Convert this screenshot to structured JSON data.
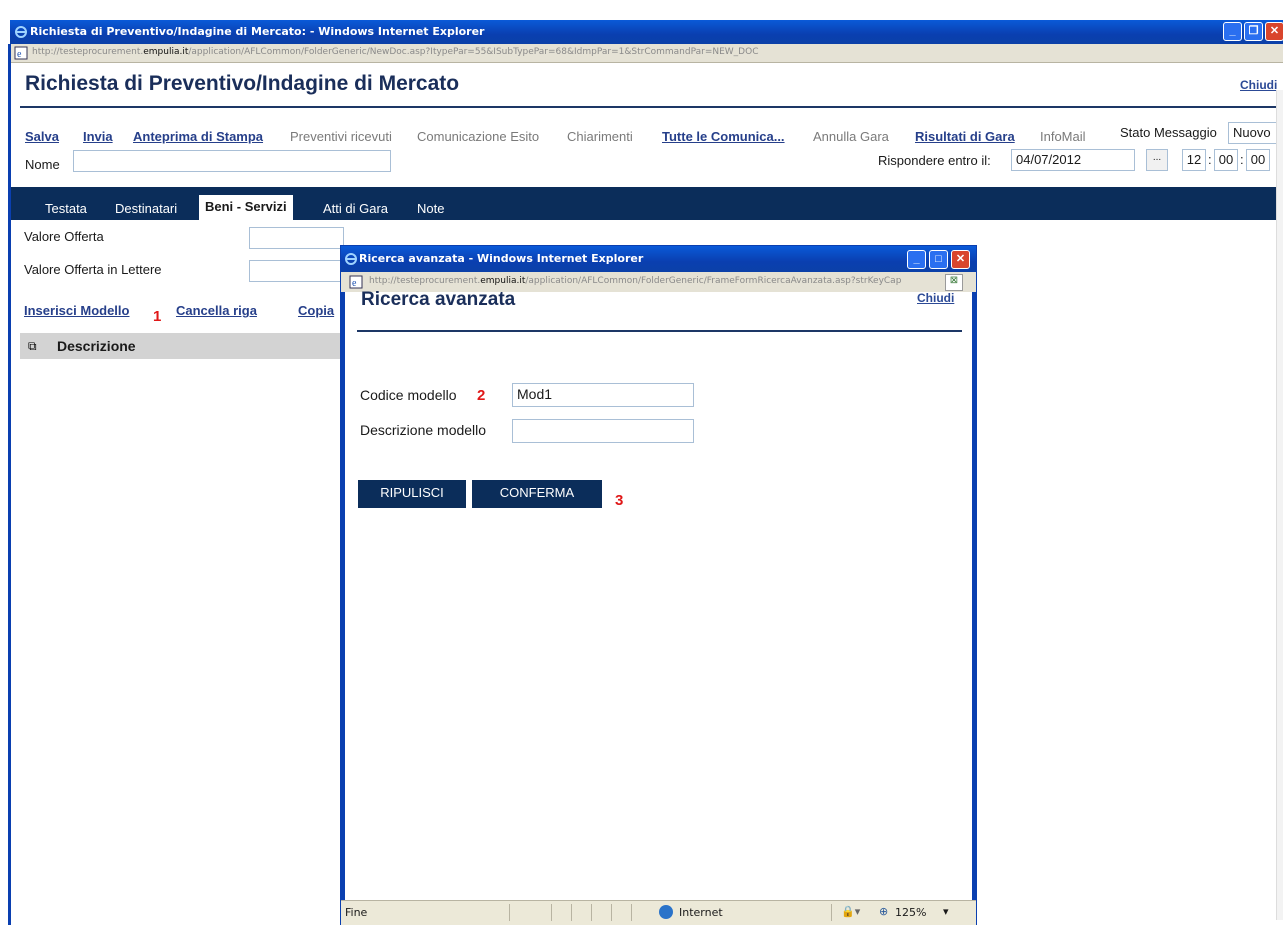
{
  "main_window": {
    "title": "Richiesta di Preventivo/Indagine di Mercato: - Windows Internet Explorer",
    "url_prefix": "http://testeprocurement.",
    "url_domain": "empulia.it",
    "url_rest": "/application/AFLCommon/FolderGeneric/NewDoc.asp?ItypePar=55&ISubTypePar=68&IdmpPar=1&StrCommandPar=NEW_DOC",
    "controls": {
      "minimize": "_",
      "maximize": "❐",
      "close": "✕"
    }
  },
  "page": {
    "title": "Richiesta di Preventivo/Indagine di Mercato",
    "close_label": "Chiudi",
    "toolbar": {
      "salva": "Salva",
      "invia": "Invia",
      "anteprima": "Anteprima di Stampa",
      "preventivi": "Preventivi ricevuti",
      "comunicazione": "Comunicazione Esito",
      "chiarimenti": "Chiarimenti",
      "tutte": "Tutte le Comunica...",
      "annulla": "Annulla Gara",
      "risultati": "Risultati di Gara",
      "infomail": "InfoMail"
    },
    "stato_label": "Stato Messaggio",
    "stato_value": "Nuovo",
    "nome_label": "Nome",
    "nome_value": "",
    "rispondere_label": "Rispondere entro il:",
    "rispondere_date": "04/07/2012",
    "date_picker_label": "...",
    "time_hour": "12",
    "time_min": "00",
    "time_sec": "00",
    "time_sep": ":",
    "tabs": [
      "Testata",
      "Destinatari",
      "Beni - Servizi",
      "Atti di Gara",
      "Note"
    ],
    "valore_offerta_label": "Valore Offerta",
    "valore_lettere_label": "Valore Offerta in Lettere",
    "links": {
      "inserisci": "Inserisci Modello",
      "cancella": "Cancella riga",
      "copia": "Copia"
    },
    "marker_1": "1",
    "grid_header": "Descrizione"
  },
  "popup": {
    "title": "Ricerca avanzata - Windows Internet Explorer",
    "url_prefix": "http://testeprocurement.",
    "url_domain": "empulia.it",
    "url_rest": "/application/AFLCommon/FolderGeneric/FrameFormRicercaAvanzata.asp?strKeyCap",
    "heading": "Ricerca avanzata",
    "close_label": "Chiudi",
    "codice_label": "Codice modello",
    "codice_value": "Mod1",
    "descrizione_label": "Descrizione modello",
    "descrizione_value": "",
    "marker_2": "2",
    "marker_3": "3",
    "ripulisci": "RIPULISCI",
    "conferma": "CONFERMA",
    "status_text": "Fine",
    "zone_label": "Internet",
    "zoom": "125%"
  }
}
